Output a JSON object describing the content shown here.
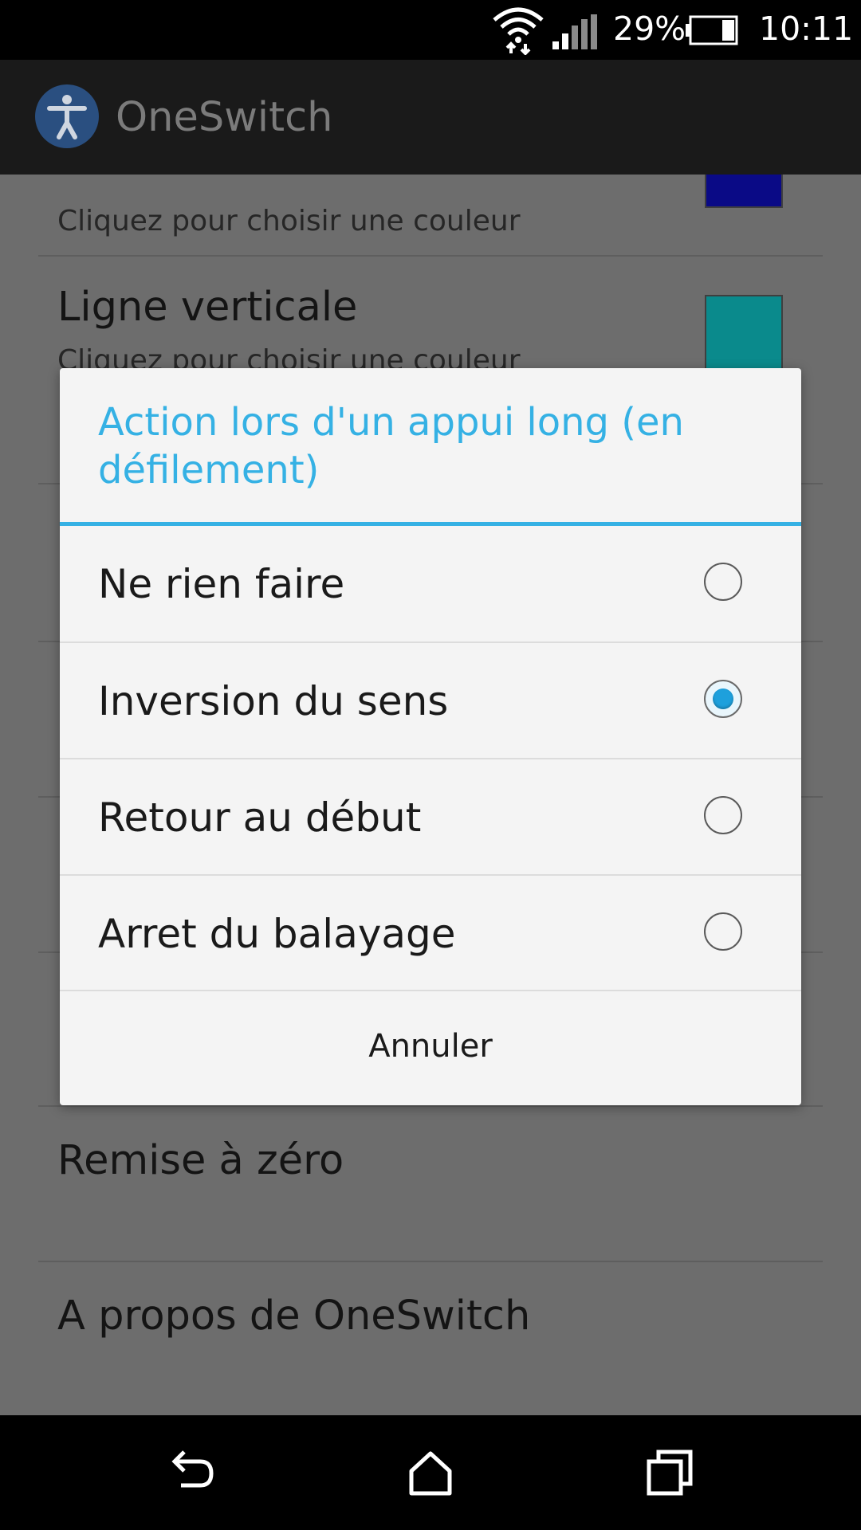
{
  "status_bar": {
    "battery_percent": "29%",
    "time": "10:11",
    "icons": [
      "wifi-data-icon",
      "cell-signal-icon",
      "battery-icon"
    ]
  },
  "action_bar": {
    "app_icon": "accessibility-icon",
    "title": "OneSwitch"
  },
  "background_list": {
    "top_row_subtitle": "Cliquez pour choisir une couleur",
    "top_row_color": "#0a0a86",
    "vertical_line": {
      "title": "Ligne verticale",
      "subtitle": "Cliquez pour choisir une couleur",
      "color": "#0a8a8c"
    },
    "reset": {
      "title": "Remise à zéro"
    },
    "about": {
      "title": "A propos de OneSwitch"
    }
  },
  "dialog": {
    "title": "Action lors d'un appui long (en défilement)",
    "accent_color": "#35b1e4",
    "options": [
      {
        "label": "Ne rien faire",
        "selected": false
      },
      {
        "label": "Inversion du sens",
        "selected": true
      },
      {
        "label": "Retour au début",
        "selected": false
      },
      {
        "label": "Arret du balayage",
        "selected": false
      }
    ],
    "cancel_label": "Annuler"
  },
  "nav_bar": {
    "buttons": [
      "back-icon",
      "home-icon",
      "recent-apps-icon"
    ]
  }
}
